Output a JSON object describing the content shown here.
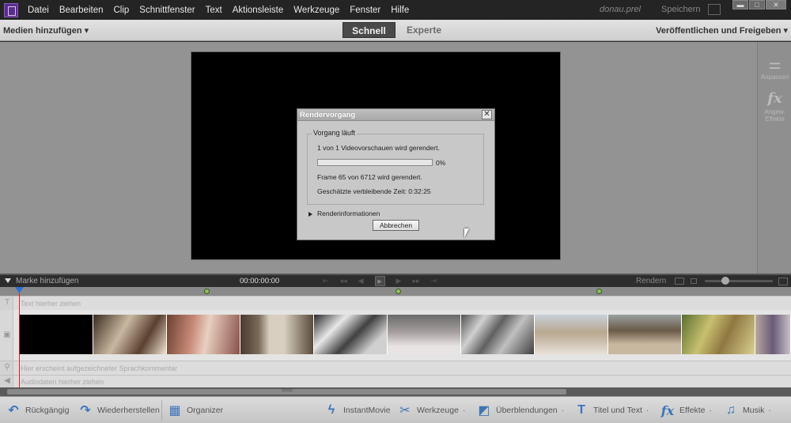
{
  "menubar": {
    "items": [
      "Datei",
      "Bearbeiten",
      "Clip",
      "Schnittfenster",
      "Text",
      "Aktionsleiste",
      "Werkzeuge",
      "Fenster",
      "Hilfe"
    ],
    "project": "donau.prel",
    "save": "Speichern"
  },
  "modebar": {
    "add_media": "Medien hinzufügen ▾",
    "mode_quick": "Schnell",
    "mode_expert": "Experte",
    "publish": "Veröffentlichen und Freigeben ▾"
  },
  "right_panel": {
    "adjust": "Anpassen",
    "fx_label": "Angew. Effekte"
  },
  "dialog": {
    "title": "Rendervorgang",
    "group": "Vorgang läuft",
    "line1": "1 von 1 Videovorschauen wird gerendert.",
    "progress_percent": 0,
    "progress_label": "0%",
    "line2": "Frame 65 von 6712 wird gerendert.",
    "line3": "Geschätzte verbleibende Zeit: 0:32:25",
    "render_info": "Renderinformationen",
    "cancel": "Abbrechen"
  },
  "timeline": {
    "add_marker": "Marke hinzufügen",
    "timecode": "00:00:00:00",
    "render": "Rendern",
    "text_track": "Text hierher ziehen",
    "narration_track": "Hier erscheint aufgezeichneter Sprachkommentar",
    "audio_track": "Audiodaten hierher ziehen"
  },
  "actionbar": {
    "undo": "Rückgängig",
    "redo": "Wiederherstellen",
    "organizer": "Organizer",
    "instantmovie": "InstantMovie",
    "tools": "Werkzeuge",
    "transitions": "Überblendungen",
    "titles": "Titel und Text",
    "effects": "Effekte",
    "music": "Musik"
  },
  "colors": {
    "accent": "#3d74b8",
    "marker": "#8fc35a",
    "playhead": "#e02020"
  }
}
